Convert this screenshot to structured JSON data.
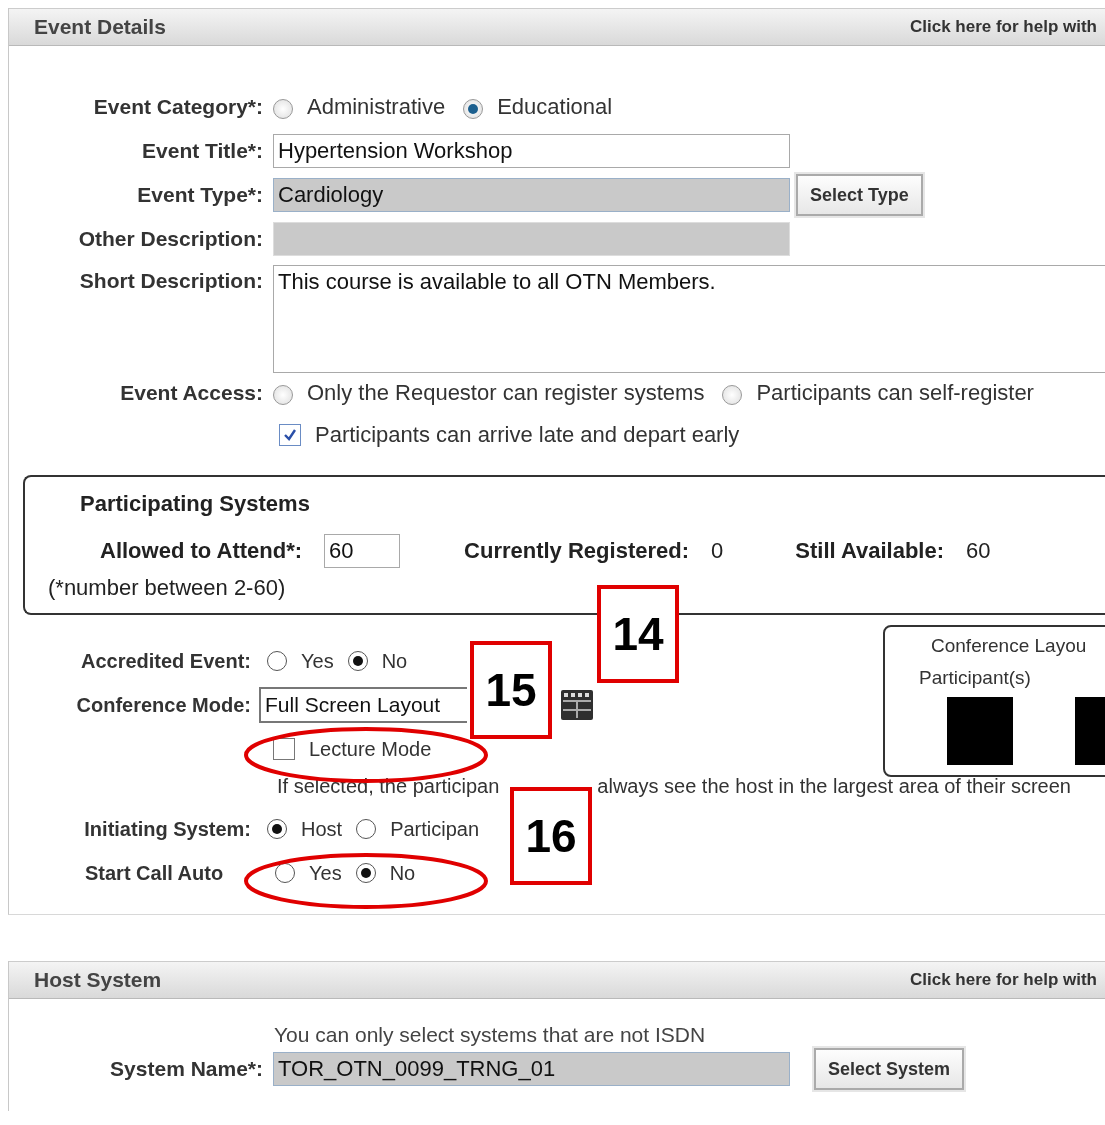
{
  "event_details": {
    "title": "Event Details",
    "help_link": "Click here for help with",
    "category": {
      "label": "Event Category*:",
      "options": [
        {
          "label": "Administrative",
          "selected": false
        },
        {
          "label": "Educational",
          "selected": true
        }
      ]
    },
    "title_field": {
      "label": "Event Title*:",
      "value": "Hypertension Workshop"
    },
    "type_field": {
      "label": "Event Type*:",
      "value": "Cardiology",
      "disabled": true,
      "button": "Select Type"
    },
    "other_description": {
      "label": "Other Description:",
      "disabled": true
    },
    "short_description": {
      "label": "Short Description:",
      "value": "This course is available to all OTN Members."
    },
    "access": {
      "label": "Event Access:",
      "options": [
        {
          "label": "Only the Requestor can register systems",
          "selected": false
        },
        {
          "label": "Participants can self-register",
          "selected": false
        }
      ]
    },
    "late_arrival": {
      "label": "Participants can arrive late and depart early",
      "checked": true
    }
  },
  "participating_systems": {
    "title": "Participating Systems",
    "allowed_label": "Allowed to Attend*:",
    "allowed_value": "60",
    "registered_label": "Currently Registered:",
    "registered_value": "0",
    "available_label": "Still Available:",
    "available_value": "60",
    "hint": "(*number between 2-60)"
  },
  "conference": {
    "accredited": {
      "label": "Accredited Event:",
      "options": [
        {
          "label": "Yes",
          "selected": false
        },
        {
          "label": "No",
          "selected": true
        }
      ]
    },
    "mode": {
      "label": "Conference Mode:",
      "value": "Full Screen Layout"
    },
    "lecture_mode": {
      "label": "Lecture Mode",
      "checked": false
    },
    "note": [
      "If selected, the participan",
      "always see the host in the largest area of their screen"
    ],
    "initiating": {
      "label": "Initiating System:",
      "options": [
        {
          "label": "Host",
          "selected": true
        },
        {
          "label": "Participan",
          "selected": false
        }
      ]
    },
    "start_call": {
      "label": "Start Call Auto",
      "options": [
        {
          "label": "Yes",
          "selected": false
        },
        {
          "label": "No",
          "selected": true
        }
      ]
    }
  },
  "layout_panel": {
    "title": "Conference Layou",
    "participants_label": "Participant(s)"
  },
  "callouts": [
    {
      "label": "14"
    },
    {
      "label": "15"
    },
    {
      "label": "16"
    }
  ],
  "host_system": {
    "title": "Host System",
    "help_link": "Click here for help with",
    "note": "You can only select systems that are not ISDN",
    "label": "System Name*:",
    "value": "TOR_OTN_0099_TRNG_01",
    "disabled": true,
    "button": "Select System"
  }
}
